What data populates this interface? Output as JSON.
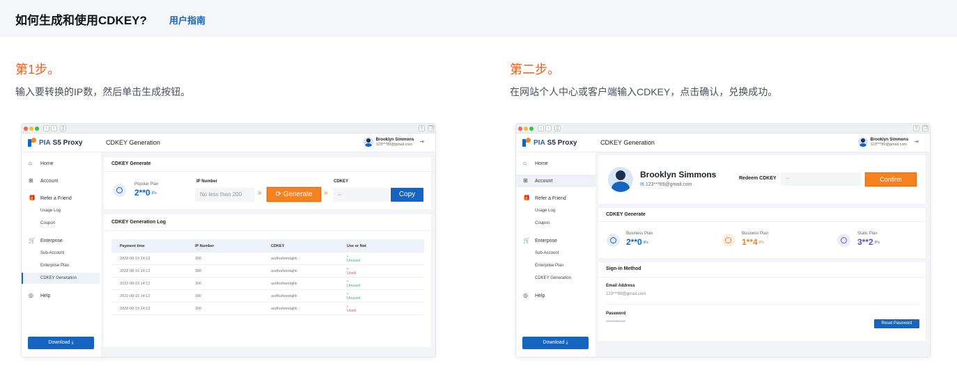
{
  "header": {
    "title": "如何生成和使用CDKEY?",
    "guide_link": "用户指南"
  },
  "steps": [
    {
      "heading": "第1步。",
      "desc": "输入要转换的IP数，然后单击生成按钮。"
    },
    {
      "heading": "第二步。",
      "desc": "在网站个人中心或客户端输入CDKEY，点击确认，兑换成功。"
    }
  ],
  "app": {
    "logo_pia": "PIA",
    "logo_rest": "S5 Proxy",
    "page_title": "CDKEY Generation",
    "user": {
      "name": "Brooklyn Simmons",
      "email": "123***89@gmail.com"
    },
    "sidebar": {
      "home": "Home",
      "account": "Account",
      "refer": "Refer a Friend",
      "usage_log": "Usage Log",
      "coupon": "Coupon",
      "enterprise": "Enterprise",
      "sub_account": "Sub-Account",
      "enterprise_plan": "Enterprise Plan",
      "cdkey_generation": "CDKEY Generation",
      "help": "Help",
      "download": "Download"
    }
  },
  "screen1": {
    "generate_title": "CDKEY Generate",
    "plan_label": "Popular Plan",
    "plan_value": "2**0",
    "plan_unit": "IPs",
    "ip_number_label": "IP Number",
    "ip_placeholder": "No less than 200",
    "generate_btn": "Generate",
    "cdkey_label": "CDKEY",
    "cdkey_value": "--",
    "copy_btn": "Copy",
    "log_title": "CDKEY Generation Log",
    "columns": [
      "Payment time",
      "IP Number",
      "CDKEY",
      "Use or Not"
    ],
    "rows": [
      [
        "2022-08-15 14:12",
        "300",
        "asdfsafwedajhk",
        "Unused"
      ],
      [
        "2022-08-15 14:12",
        "300",
        "asdfsafwedajhk",
        "Used"
      ],
      [
        "2022-08-15 14:12",
        "300",
        "asdfsafwedajhk",
        "Unused"
      ],
      [
        "2022-08-15 14:12",
        "300",
        "asdfsafwedajhk",
        "Unused"
      ],
      [
        "2022-08-15 14:12",
        "300",
        "asdfsafwedajhk",
        "Used"
      ]
    ]
  },
  "screen2": {
    "profile_name": "Brooklyn Simmons",
    "profile_email": "123***89@gmail.com",
    "redeem_label": "Redeem CDKEY",
    "redeem_value": "--",
    "confirm_btn": "Confirm",
    "generate_title": "CDKEY Generate",
    "plans": [
      {
        "label": "Business Plan",
        "value": "2**0",
        "unit": "IPs"
      },
      {
        "label": "Business Plan",
        "value": "1**4",
        "unit": "IPs"
      },
      {
        "label": "Static Plan",
        "value": "3**2",
        "unit": "IPs"
      }
    ],
    "signin_title": "Sign-in Method",
    "email_label": "Email Address",
    "email_value": "123***89@gmail.com",
    "password_label": "Password",
    "password_value": "************",
    "reset_btn": "Reset Password"
  },
  "colors": {
    "accent_blue": "#1565c0",
    "accent_orange": "#f58220",
    "heading_orange": "#e8601c"
  }
}
